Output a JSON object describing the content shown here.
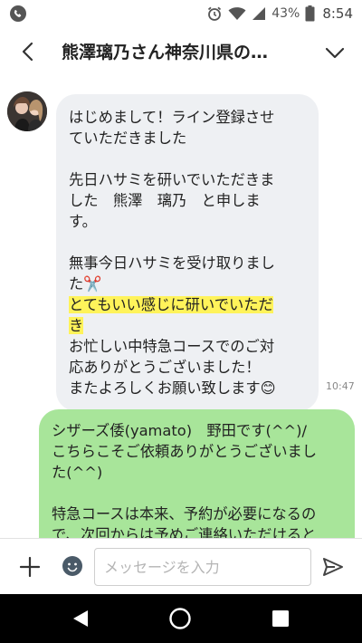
{
  "status_bar": {
    "battery_text": "43%",
    "time": "8:54",
    "icons": [
      "phone-icon",
      "alarm-icon",
      "wifi-icon",
      "signal-icon",
      "battery-icon"
    ]
  },
  "header": {
    "title": "熊澤璃乃さん神奈川県の…",
    "icons": [
      "back-arrow-icon",
      "chevron-down-icon"
    ]
  },
  "messages": {
    "incoming": {
      "avatar": "avatar",
      "p1": "はじめまして！ライン登録させ\nていただきました",
      "p2": "先日ハサミを研いでいただきま\nした　熊澤　璃乃　と申しま\nす。",
      "p3_line1": "無事今日ハサミを受け取りまし",
      "p3_line2": "た",
      "p3_emoji": "✂️",
      "p3_highlight1": "とてもいい感じに研いでいただ",
      "p3_highlight2": "き",
      "p3_rest": "お忙しい中特急コースでのご対\n応ありがとうございました！\nまたよろしくお願い致します",
      "p3_end_emoji": "😊",
      "time": "10:47"
    },
    "outgoing": {
      "p1": "シザーズ倭(yamato)　野田です(^^)/\nこちらこそご依頼ありがとうございまし\nた(^^)",
      "p2": "特急コースは本来、予約が必要になるの\nで、次回からは予めご連絡いただけると"
    }
  },
  "input_bar": {
    "placeholder": "メッセージを入力",
    "icons": [
      "plus-icon",
      "emoji-icon",
      "send-icon"
    ]
  },
  "nav_bar": {
    "icons": [
      "nav-back-icon",
      "nav-home-icon",
      "nav-recent-icon"
    ]
  },
  "colors": {
    "incoming_bubble": "#eef0f3",
    "outgoing_bubble": "#a8e59a",
    "highlight": "#fff35a"
  }
}
